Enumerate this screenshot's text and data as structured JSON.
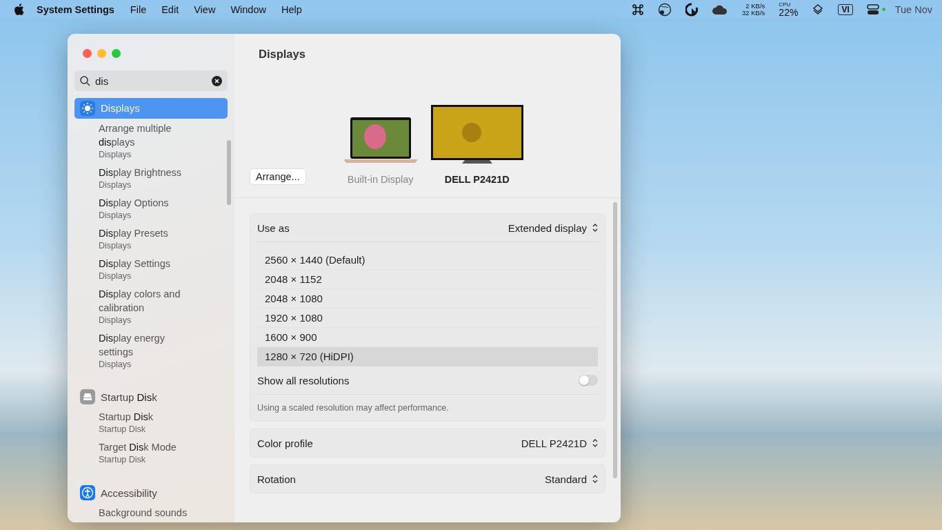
{
  "menu_bar": {
    "app_name": "System Settings",
    "menus": [
      "File",
      "Edit",
      "View",
      "Window",
      "Help"
    ],
    "status": {
      "net_up": "2 KB/s",
      "net_down": "32 KB/s",
      "cpu_label": "CPU",
      "cpu_value": "22%",
      "input_source": "VI",
      "clock": "Tue Nov"
    }
  },
  "sidebar": {
    "search": {
      "value": "dis"
    },
    "groups": [
      {
        "title": "**Dis**plays",
        "selected": true,
        "kind": "displays",
        "results": [
          {
            "title": "Arrange multiple **dis**plays",
            "subtitle": "Displays"
          },
          {
            "title": "**Dis**play Brightness",
            "subtitle": "Displays"
          },
          {
            "title": "**Dis**play Options",
            "subtitle": "Displays"
          },
          {
            "title": "**Dis**play Presets",
            "subtitle": "Displays"
          },
          {
            "title": "**Dis**play Settings",
            "subtitle": "Displays"
          },
          {
            "title": "**Dis**play colors and calibration",
            "subtitle": "Displays"
          },
          {
            "title": "**Dis**play energy settings",
            "subtitle": "Displays"
          }
        ]
      },
      {
        "title": "Startup **Dis**k",
        "selected": false,
        "kind": "disk",
        "results": [
          {
            "title": "Startup **Dis**k",
            "subtitle": "Startup Disk"
          },
          {
            "title": "Target **Dis**k Mode",
            "subtitle": "Startup Disk"
          }
        ]
      },
      {
        "title": "Accessibility",
        "selected": false,
        "kind": "accessibility",
        "results": [
          {
            "title": "Background sounds"
          }
        ]
      }
    ]
  },
  "main": {
    "title": "Displays",
    "arrange_button": "Arrange...",
    "displays": [
      {
        "name": "Built-in Display",
        "kind": "laptop",
        "selected": false
      },
      {
        "name": "DELL P2421D",
        "kind": "monitor",
        "selected": true
      }
    ],
    "use_as": {
      "label": "Use as",
      "value": "Extended display"
    },
    "resolutions": [
      {
        "label": "2560 × 1440 (Default)",
        "selected": false
      },
      {
        "label": "2048 × 1152",
        "selected": false
      },
      {
        "label": "2048 × 1080",
        "selected": false
      },
      {
        "label": "1920 × 1080",
        "selected": false
      },
      {
        "label": "1600 × 900",
        "selected": false
      },
      {
        "label": "1280 × 720 (HiDPI)",
        "selected": true
      }
    ],
    "show_all": {
      "label": "Show all resolutions",
      "on": false
    },
    "note": "Using a scaled resolution may affect performance.",
    "color_profile": {
      "label": "Color profile",
      "value": "DELL P2421D"
    },
    "rotation": {
      "label": "Rotation",
      "value": "Standard"
    }
  }
}
